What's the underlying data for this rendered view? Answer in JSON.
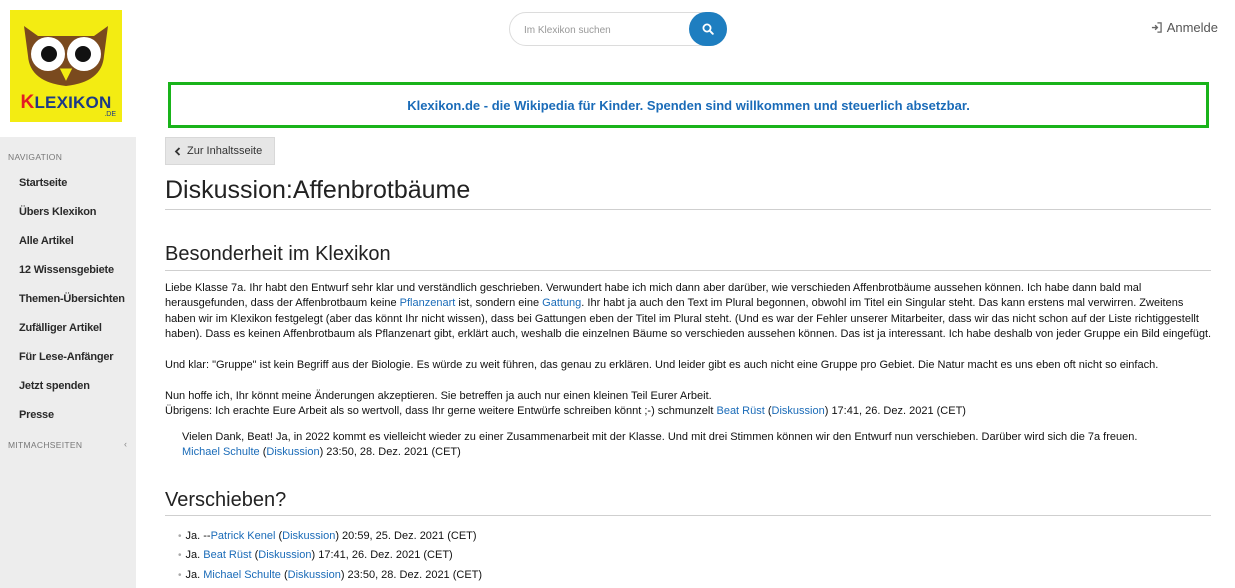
{
  "logo": {
    "k": "K",
    "rest": "LEXIKON",
    "tld": ".DE"
  },
  "navigation": {
    "heading": "NAVIGATION",
    "items": [
      "Startseite",
      "Übers Klexikon",
      "Alle Artikel",
      "12 Wissensgebiete",
      "Themen-Übersichten",
      "Zufälliger Artikel",
      "Für Lese-Anfänger",
      "Jetzt spenden",
      "Presse"
    ],
    "heading2": "MITMACHSEITEN"
  },
  "search": {
    "placeholder": "Im Klexikon suchen"
  },
  "login": "Anmelde",
  "banner": "Klexikon.de - die Wikipedia für Kinder. Spenden sind willkommen und steuerlich absetzbar.",
  "back_button": "Zur Inhaltsseite",
  "title": "Diskussion:Affenbrotbäume",
  "section1": {
    "heading": "Besonderheit im Klexikon",
    "p1_a": "Liebe Klasse 7a. Ihr habt den Entwurf sehr klar und verständlich geschrieben. Verwundert habe ich mich dann aber darüber, wie verschieden Affenbrotbäume aussehen können. Ich habe dann bald mal herausgefunden, dass der Affenbrotbaum keine ",
    "link_pflanzenart": "Pflanzenart",
    "p1_b": " ist, sondern eine ",
    "link_gattung": "Gattung",
    "p1_c": ". Ihr habt ja auch den Text im Plural begonnen, obwohl im Titel ein Singular steht. Das kann erstens mal verwirren. Zweitens haben wir im Klexikon festgelegt (aber das könnt Ihr nicht wissen), dass bei Gattungen eben der Titel im Plural steht. (Und es war der Fehler unserer Mitarbeiter, dass wir das nicht schon auf der Liste richtiggestellt haben). Dass es keinen Affenbrotbaum als Pflanzenart gibt, erklärt auch, weshalb die einzelnen Bäume so verschieden aussehen können. Das ist ja interessant. Ich habe deshalb von jeder Gruppe ein Bild eingefügt.",
    "p2": "Und klar: \"Gruppe\" ist kein Begriff aus der Biologie. Es würde zu weit führen, das genau zu erklären. Und leider gibt es auch nicht eine Gruppe pro Gebiet. Die Natur macht es uns eben oft nicht so einfach.",
    "p3": "Nun hoffe ich, Ihr könnt meine Änderungen akzeptieren. Sie betreffen ja auch nur einen kleinen Teil Eurer Arbeit.",
    "p4_a": "Übrigens: Ich erachte Eure Arbeit als so wertvoll, dass Ihr gerne weitere Entwürfe schreiben könnt ;-) schmunzelt ",
    "p4_user": "Beat Rüst",
    "p4_open": " (",
    "p4_disk": "Diskussion",
    "p4_close": ") 17:41, 26. Dez. 2021 (CET)",
    "reply_text": "Vielen Dank, Beat! Ja, in 2022 kommt es vielleicht wieder zu einer Zusammenarbeit mit der Klasse. Und mit drei Stimmen können wir den Entwurf nun verschieben. Darüber wird sich die 7a freuen.",
    "reply_user": "Michael Schulte",
    "reply_open": " (",
    "reply_disk": "Diskussion",
    "reply_close": ") 23:50, 28. Dez. 2021 (CET)"
  },
  "section2": {
    "heading": "Verschieben?",
    "votes": [
      {
        "prefix": "Ja. --",
        "user": "Patrick Kenel",
        "disk": "Diskussion",
        "time": ") 20:59, 25. Dez. 2021 (CET)"
      },
      {
        "prefix": "Ja. ",
        "user": "Beat Rüst",
        "disk": "Diskussion",
        "time": ") 17:41, 26. Dez. 2021 (CET)"
      },
      {
        "prefix": "Ja. ",
        "user": "Michael Schulte",
        "disk": "Diskussion",
        "time": ") 23:50, 28. Dez. 2021 (CET)"
      }
    ],
    "open_paren": " ("
  },
  "colors": {
    "link": "#1a6bb8",
    "banner_border": "#19b31a",
    "search_button": "#1e7ec0",
    "logo_bg": "#f3ec12"
  }
}
